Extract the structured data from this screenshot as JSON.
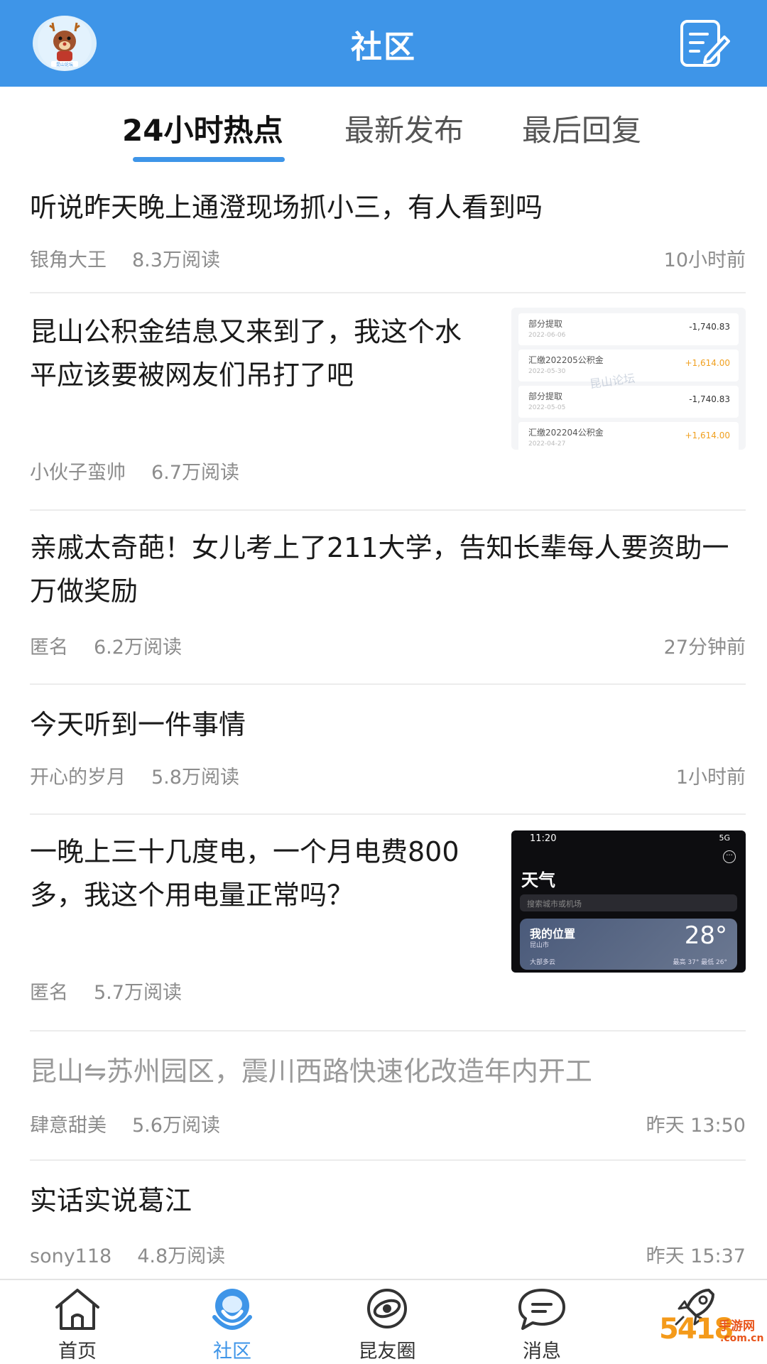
{
  "header": {
    "title": "社区",
    "avatar_caption": "昆山论坛"
  },
  "tabs": [
    {
      "label": "24小时热点",
      "active": true
    },
    {
      "label": "最新发布",
      "active": false
    },
    {
      "label": "最后回复",
      "active": false
    }
  ],
  "posts": [
    {
      "title": "听说昨天晚上通澄现场抓小三，有人看到吗",
      "author": "银角大王",
      "reads": "8.3万阅读",
      "time": "10小时前"
    },
    {
      "title": "昆山公积金结息又来到了，我这个水平应该要被网友们吊打了吧",
      "author": "小伙子蛮帅",
      "reads": "6.7万阅读",
      "time": "",
      "thumbnail": {
        "watermark": "昆山论坛",
        "rows": [
          {
            "name": "部分提取",
            "date": "2022-06-06",
            "amount": "-1,740.83",
            "positive": false
          },
          {
            "name": "汇缴202205公积金",
            "date": "2022-05-30",
            "amount": "+1,614.00",
            "positive": true
          },
          {
            "name": "部分提取",
            "date": "2022-05-05",
            "amount": "-1,740.83",
            "positive": false
          },
          {
            "name": "汇缴202204公积金",
            "date": "2022-04-27",
            "amount": "+1,614.00",
            "positive": true
          }
        ]
      }
    },
    {
      "title": "亲戚太奇葩！女儿考上了211大学，告知长辈每人要资助一万做奖励",
      "author": "匿名",
      "reads": "6.2万阅读",
      "time": "27分钟前"
    },
    {
      "title": "今天听到一件事情",
      "author": "开心的岁月",
      "reads": "5.8万阅读",
      "time": "1小时前"
    },
    {
      "title": "一晚上三十几度电，一个月电费800多，我这个用电量正常吗？",
      "author": "匿名",
      "reads": "5.7万阅读",
      "time": "",
      "thumbnail": {
        "status_time": "11:20",
        "status_right": "5G",
        "app_title": "天气",
        "search_placeholder": "搜索城市或机场",
        "location": "我的位置",
        "city": "昆山市",
        "temperature": "28°",
        "condition": "大部多云",
        "high_low": "最高 37° 最低 26°"
      }
    },
    {
      "title": "昆山⇋苏州园区，震川西路快速化改造年内开工",
      "author": "肆意甜美",
      "reads": "5.6万阅读",
      "time": "昨天 13:50"
    },
    {
      "title": "实话实说葛江",
      "author": "sony118",
      "reads": "4.8万阅读",
      "time": "昨天 15:37"
    }
  ],
  "tabbar": [
    {
      "label": "首页",
      "icon": "home-icon",
      "active": false
    },
    {
      "label": "社区",
      "icon": "community-icon",
      "active": true
    },
    {
      "label": "昆友圈",
      "icon": "planet-icon",
      "active": false
    },
    {
      "label": "消息",
      "icon": "message-icon",
      "active": false
    },
    {
      "label": "",
      "icon": "rocket-icon",
      "active": false
    }
  ],
  "watermark": {
    "big": "5418",
    "small": "手游网",
    "tiny": ".com.cn"
  },
  "colors": {
    "accent": "#3e95e8",
    "header_bg": "#3e95e8"
  }
}
